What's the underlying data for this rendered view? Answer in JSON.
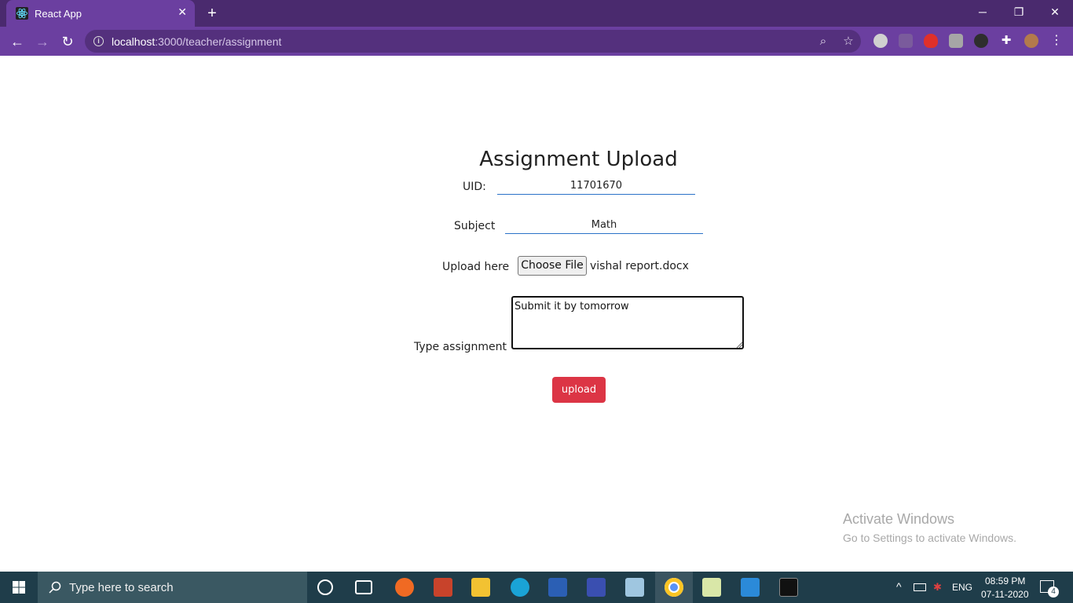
{
  "browser": {
    "tab_title": "React App",
    "url_host": "localhost",
    "url_rest": ":3000/teacher/assignment"
  },
  "page": {
    "heading": "Assignment Upload",
    "uid_label": "UID:",
    "uid_value": "11701670",
    "subject_label": "Subject",
    "subject_value": "Math",
    "upload_label": "Upload here",
    "choose_file_label": "Choose File",
    "file_name": "vishal report.docx",
    "type_label": "Type assignment",
    "assignment_text": "Submit it by tomorrow",
    "upload_button": "upload"
  },
  "watermark": {
    "line1": "Activate Windows",
    "line2": "Go to Settings to activate Windows."
  },
  "taskbar": {
    "search_placeholder": "Type here to search",
    "language": "ENG",
    "time": "08:59 PM",
    "date": "07-11-2020",
    "notification_count": "4"
  },
  "colors": {
    "chrome_dark": "#4a2a6e",
    "chrome_accent": "#6b3fa0",
    "upload_button": "#dc3545",
    "input_underline": "#2a72c8"
  }
}
